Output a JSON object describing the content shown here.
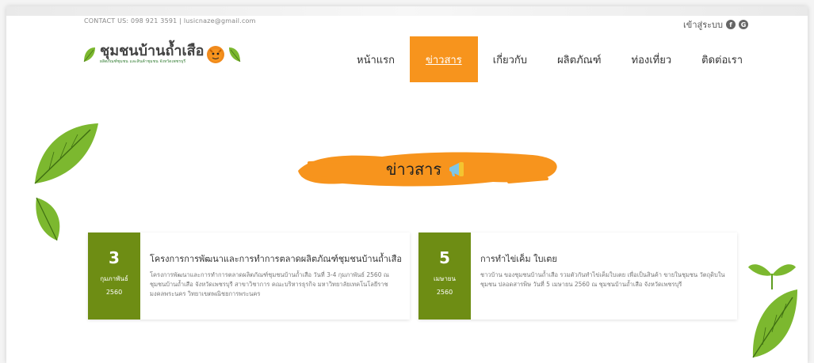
{
  "header": {
    "contact": "CONTACT US: 098 921 3591 | lusicnaze@gmail.com",
    "login_label": "เข้าสู่ระบบ",
    "social_1": "f",
    "social_2": "G"
  },
  "logo": {
    "title": "ชุมชนบ้านถ้ำเสือ",
    "subtitle": "ผลิตภัณฑ์ชุมชน และสินค้าชุมชน จังหวัดเพชรบุรี"
  },
  "nav": {
    "items": [
      {
        "label": "หน้าแรก"
      },
      {
        "label": "ข่าวสาร"
      },
      {
        "label": "เกี่ยวกับ"
      },
      {
        "label": "ผลิตภัณฑ์"
      },
      {
        "label": "ท่องเที่ยว"
      },
      {
        "label": "ติดต่อเรา"
      }
    ],
    "active_index": 1
  },
  "banner": {
    "title": "ข่าวสาร",
    "icon": "megaphone-icon"
  },
  "news": [
    {
      "day": "3",
      "month": "กุมภาพันธ์",
      "year": "2560",
      "title": "โครงการการพัฒนาและการทำการตลาดผลิตภัณฑ์ชุมชนบ้านถ้ำเสือ",
      "description": "โครงการพัฒนาและการทำการตลาดผลิตภัณฑ์ชุมชนบ้านถ้ำเสือ วันที่ 3-4 กุมภาพันธ์ 2560 ณ ชุมชนบ้านถ้ำเสือ จังหวัดเพชรบุรี สาขาวิชาการ คณะบริหารธุรกิจ มหาวิทยาลัยเทคโนโลยีราชมงคลพระนคร วิทยาเขตพณิชยการพระนคร"
    },
    {
      "day": "5",
      "month": "เมษายน",
      "year": "2560",
      "title": "การทำไข่เค็ม ใบเตย",
      "description": "ชาวบ้าน ของชุมชนบ้านถ้ำเสือ รวมตัวกันทำไข่เค็มใบเตย เพื่อเป็นสินค้า ขายในชุมชน วัตถุดิบในชุมชน ปลอดสารพิษ วันที่ 5 เมษายน 2560 ณ ชุมชนบ้านถ้ำเสือ จังหวัดเพชรบุรี"
    }
  ],
  "colors": {
    "accent_orange": "#f7941d",
    "date_green": "#6e8d14",
    "leaf_green": "#7cb82f"
  }
}
